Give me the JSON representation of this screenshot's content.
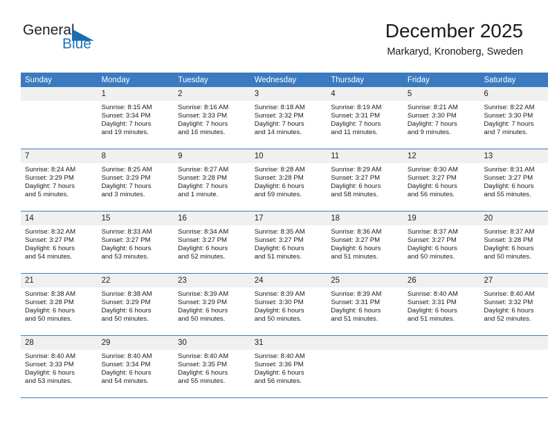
{
  "brand": {
    "name_top": "General",
    "name_bottom": "Blue",
    "accent_color": "#1c75bc"
  },
  "header": {
    "title": "December 2025",
    "subtitle": "Markaryd, Kronoberg, Sweden"
  },
  "theme": {
    "header_blue": "#3a7ac0",
    "daynum_bg": "#f0f0f0",
    "text": "#1a1a1a"
  },
  "weekday_headers": [
    "Sunday",
    "Monday",
    "Tuesday",
    "Wednesday",
    "Thursday",
    "Friday",
    "Saturday"
  ],
  "weeks": [
    [
      {
        "day": "",
        "sunrise": "",
        "sunset": "",
        "daylight_1": "",
        "daylight_2": "",
        "empty": true
      },
      {
        "day": "1",
        "sunrise": "Sunrise: 8:15 AM",
        "sunset": "Sunset: 3:34 PM",
        "daylight_1": "Daylight: 7 hours",
        "daylight_2": "and 19 minutes."
      },
      {
        "day": "2",
        "sunrise": "Sunrise: 8:16 AM",
        "sunset": "Sunset: 3:33 PM",
        "daylight_1": "Daylight: 7 hours",
        "daylight_2": "and 16 minutes."
      },
      {
        "day": "3",
        "sunrise": "Sunrise: 8:18 AM",
        "sunset": "Sunset: 3:32 PM",
        "daylight_1": "Daylight: 7 hours",
        "daylight_2": "and 14 minutes."
      },
      {
        "day": "4",
        "sunrise": "Sunrise: 8:19 AM",
        "sunset": "Sunset: 3:31 PM",
        "daylight_1": "Daylight: 7 hours",
        "daylight_2": "and 11 minutes."
      },
      {
        "day": "5",
        "sunrise": "Sunrise: 8:21 AM",
        "sunset": "Sunset: 3:30 PM",
        "daylight_1": "Daylight: 7 hours",
        "daylight_2": "and 9 minutes."
      },
      {
        "day": "6",
        "sunrise": "Sunrise: 8:22 AM",
        "sunset": "Sunset: 3:30 PM",
        "daylight_1": "Daylight: 7 hours",
        "daylight_2": "and 7 minutes."
      }
    ],
    [
      {
        "day": "7",
        "sunrise": "Sunrise: 8:24 AM",
        "sunset": "Sunset: 3:29 PM",
        "daylight_1": "Daylight: 7 hours",
        "daylight_2": "and 5 minutes."
      },
      {
        "day": "8",
        "sunrise": "Sunrise: 8:25 AM",
        "sunset": "Sunset: 3:29 PM",
        "daylight_1": "Daylight: 7 hours",
        "daylight_2": "and 3 minutes."
      },
      {
        "day": "9",
        "sunrise": "Sunrise: 8:27 AM",
        "sunset": "Sunset: 3:28 PM",
        "daylight_1": "Daylight: 7 hours",
        "daylight_2": "and 1 minute."
      },
      {
        "day": "10",
        "sunrise": "Sunrise: 8:28 AM",
        "sunset": "Sunset: 3:28 PM",
        "daylight_1": "Daylight: 6 hours",
        "daylight_2": "and 59 minutes."
      },
      {
        "day": "11",
        "sunrise": "Sunrise: 8:29 AM",
        "sunset": "Sunset: 3:27 PM",
        "daylight_1": "Daylight: 6 hours",
        "daylight_2": "and 58 minutes."
      },
      {
        "day": "12",
        "sunrise": "Sunrise: 8:30 AM",
        "sunset": "Sunset: 3:27 PM",
        "daylight_1": "Daylight: 6 hours",
        "daylight_2": "and 56 minutes."
      },
      {
        "day": "13",
        "sunrise": "Sunrise: 8:31 AM",
        "sunset": "Sunset: 3:27 PM",
        "daylight_1": "Daylight: 6 hours",
        "daylight_2": "and 55 minutes."
      }
    ],
    [
      {
        "day": "14",
        "sunrise": "Sunrise: 8:32 AM",
        "sunset": "Sunset: 3:27 PM",
        "daylight_1": "Daylight: 6 hours",
        "daylight_2": "and 54 minutes."
      },
      {
        "day": "15",
        "sunrise": "Sunrise: 8:33 AM",
        "sunset": "Sunset: 3:27 PM",
        "daylight_1": "Daylight: 6 hours",
        "daylight_2": "and 53 minutes."
      },
      {
        "day": "16",
        "sunrise": "Sunrise: 8:34 AM",
        "sunset": "Sunset: 3:27 PM",
        "daylight_1": "Daylight: 6 hours",
        "daylight_2": "and 52 minutes."
      },
      {
        "day": "17",
        "sunrise": "Sunrise: 8:35 AM",
        "sunset": "Sunset: 3:27 PM",
        "daylight_1": "Daylight: 6 hours",
        "daylight_2": "and 51 minutes."
      },
      {
        "day": "18",
        "sunrise": "Sunrise: 8:36 AM",
        "sunset": "Sunset: 3:27 PM",
        "daylight_1": "Daylight: 6 hours",
        "daylight_2": "and 51 minutes."
      },
      {
        "day": "19",
        "sunrise": "Sunrise: 8:37 AM",
        "sunset": "Sunset: 3:27 PM",
        "daylight_1": "Daylight: 6 hours",
        "daylight_2": "and 50 minutes."
      },
      {
        "day": "20",
        "sunrise": "Sunrise: 8:37 AM",
        "sunset": "Sunset: 3:28 PM",
        "daylight_1": "Daylight: 6 hours",
        "daylight_2": "and 50 minutes."
      }
    ],
    [
      {
        "day": "21",
        "sunrise": "Sunrise: 8:38 AM",
        "sunset": "Sunset: 3:28 PM",
        "daylight_1": "Daylight: 6 hours",
        "daylight_2": "and 50 minutes."
      },
      {
        "day": "22",
        "sunrise": "Sunrise: 8:38 AM",
        "sunset": "Sunset: 3:29 PM",
        "daylight_1": "Daylight: 6 hours",
        "daylight_2": "and 50 minutes."
      },
      {
        "day": "23",
        "sunrise": "Sunrise: 8:39 AM",
        "sunset": "Sunset: 3:29 PM",
        "daylight_1": "Daylight: 6 hours",
        "daylight_2": "and 50 minutes."
      },
      {
        "day": "24",
        "sunrise": "Sunrise: 8:39 AM",
        "sunset": "Sunset: 3:30 PM",
        "daylight_1": "Daylight: 6 hours",
        "daylight_2": "and 50 minutes."
      },
      {
        "day": "25",
        "sunrise": "Sunrise: 8:39 AM",
        "sunset": "Sunset: 3:31 PM",
        "daylight_1": "Daylight: 6 hours",
        "daylight_2": "and 51 minutes."
      },
      {
        "day": "26",
        "sunrise": "Sunrise: 8:40 AM",
        "sunset": "Sunset: 3:31 PM",
        "daylight_1": "Daylight: 6 hours",
        "daylight_2": "and 51 minutes."
      },
      {
        "day": "27",
        "sunrise": "Sunrise: 8:40 AM",
        "sunset": "Sunset: 3:32 PM",
        "daylight_1": "Daylight: 6 hours",
        "daylight_2": "and 52 minutes."
      }
    ],
    [
      {
        "day": "28",
        "sunrise": "Sunrise: 8:40 AM",
        "sunset": "Sunset: 3:33 PM",
        "daylight_1": "Daylight: 6 hours",
        "daylight_2": "and 53 minutes."
      },
      {
        "day": "29",
        "sunrise": "Sunrise: 8:40 AM",
        "sunset": "Sunset: 3:34 PM",
        "daylight_1": "Daylight: 6 hours",
        "daylight_2": "and 54 minutes."
      },
      {
        "day": "30",
        "sunrise": "Sunrise: 8:40 AM",
        "sunset": "Sunset: 3:35 PM",
        "daylight_1": "Daylight: 6 hours",
        "daylight_2": "and 55 minutes."
      },
      {
        "day": "31",
        "sunrise": "Sunrise: 8:40 AM",
        "sunset": "Sunset: 3:36 PM",
        "daylight_1": "Daylight: 6 hours",
        "daylight_2": "and 56 minutes."
      },
      {
        "day": "",
        "sunrise": "",
        "sunset": "",
        "daylight_1": "",
        "daylight_2": "",
        "empty": true
      },
      {
        "day": "",
        "sunrise": "",
        "sunset": "",
        "daylight_1": "",
        "daylight_2": "",
        "empty": true
      },
      {
        "day": "",
        "sunrise": "",
        "sunset": "",
        "daylight_1": "",
        "daylight_2": "",
        "empty": true
      }
    ]
  ]
}
